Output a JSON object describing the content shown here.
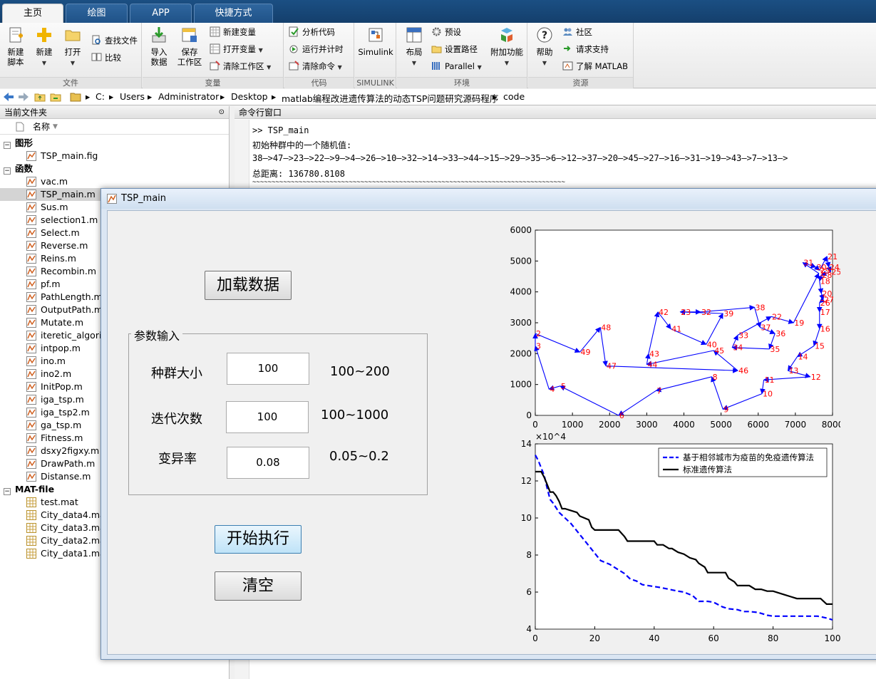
{
  "tabs": [
    "主页",
    "绘图",
    "APP",
    "快捷方式"
  ],
  "ribbon": {
    "file": {
      "label": "文件",
      "new_script": "新建\n脚本",
      "new": "新建",
      "open": "打开",
      "find_files": "查找文件",
      "compare": "比较"
    },
    "variable": {
      "label": "变量",
      "import": "导入\n数据",
      "save_ws": "保存\n工作区",
      "new_var": "新建变量",
      "open_var": "打开变量",
      "clear_ws": "清除工作区"
    },
    "code": {
      "label": "代码",
      "analyze": "分析代码",
      "run_time": "运行并计时",
      "clear_cmd": "清除命令"
    },
    "simulink": {
      "label": "SIMULINK",
      "btn": "Simulink"
    },
    "env": {
      "label": "环境",
      "layout": "布局",
      "prefs": "预设",
      "set_path": "设置路径",
      "parallel": "Parallel",
      "addons": "附加功能"
    },
    "resources": {
      "label": "资源",
      "help": "帮助",
      "community": "社区",
      "support": "请求支持",
      "learn": "了解 MATLAB"
    }
  },
  "address": {
    "parts": [
      "C:",
      "Users",
      "Administrator",
      "Desktop",
      "matlab编程改进遗传算法的动态TSP问题研究源码程序",
      "code"
    ]
  },
  "file_panel": {
    "title": "当前文件夹",
    "column": "名称",
    "sections": [
      {
        "name": "图形",
        "files": [
          "TSP_main.fig"
        ]
      },
      {
        "name": "函数",
        "files": [
          "vac.m",
          "TSP_main.m",
          "Sus.m",
          "selection1.m",
          "Select.m",
          "Reverse.m",
          "Reins.m",
          "Recombin.m",
          "pf.m",
          "PathLength.m",
          "OutputPath.m",
          "Mutate.m",
          "iteretic_algorit",
          "intpop.m",
          "ino.m",
          "ino2.m",
          "InitPop.m",
          "iga_tsp.m",
          "iga_tsp2.m",
          "ga_tsp.m",
          "Fitness.m",
          "dsxy2figxy.m",
          "DrawPath.m",
          "Distanse.m"
        ]
      },
      {
        "name": "MAT-file",
        "files": [
          "test.mat",
          "City_data4.mat",
          "City_data3.mat",
          "City_data2.mat",
          "City_data1.mat"
        ]
      }
    ],
    "selected": "TSP_main.m"
  },
  "command_window": {
    "title": "命令行窗口",
    "lines": [
      ">> TSP_main",
      "初始种群中的一个随机值:",
      "38—>47—>23—>22—>9—>4—>26—>10—>32—>14—>33—>44—>15—>29—>35—>6—>12—>37—>20—>45—>27—>16—>31—>19—>43—>7—>13—>",
      "总距离: 136780.8108",
      "~~~~~~~~~~~~~~~~~~~~~~~~~~~~~~~~~~~~~~~~~~~~~~~~~~~~~~~~~~~~~~~~~~~~~~~~~~~~~~~~~"
    ]
  },
  "figure": {
    "title": "TSP_main",
    "load_button": "加载数据",
    "param_title": "参数输入",
    "params": [
      {
        "label": "种群大小",
        "value": "100",
        "range": "100~200"
      },
      {
        "label": "迭代次数",
        "value": "100",
        "range": "100~1000"
      },
      {
        "label": "变异率",
        "value": "0.08",
        "range": "0.05~0.2"
      }
    ],
    "start_button": "开始执行",
    "clear_button": "清空"
  },
  "colors": {
    "route": "#0000ff",
    "city_label": "#ff0000",
    "ribbon_tab_bg": "#1b4f83"
  },
  "chart_data": [
    {
      "type": "scatter",
      "xlim": [
        0,
        8000
      ],
      "ylim": [
        0,
        6000
      ],
      "xticks": [
        0,
        1000,
        2000,
        3000,
        4000,
        5000,
        6000,
        7000,
        8000
      ],
      "yticks": [
        0,
        1000,
        2000,
        3000,
        4000,
        5000,
        6000
      ],
      "points": [
        {
          "id": 1,
          "x": 7630,
          "y": 4600
        },
        {
          "id": 2,
          "x": 0,
          "y": 2650
        },
        {
          "id": 3,
          "x": 0,
          "y": 2250
        },
        {
          "id": 4,
          "x": 370,
          "y": 850
        },
        {
          "id": 5,
          "x": 670,
          "y": 950
        },
        {
          "id": 6,
          "x": 2240,
          "y": 0
        },
        {
          "id": 7,
          "x": 3250,
          "y": 800
        },
        {
          "id": 8,
          "x": 4750,
          "y": 1250
        },
        {
          "id": 9,
          "x": 5050,
          "y": 200
        },
        {
          "id": 10,
          "x": 6100,
          "y": 700
        },
        {
          "id": 11,
          "x": 6150,
          "y": 1150
        },
        {
          "id": 12,
          "x": 7400,
          "y": 1250
        },
        {
          "id": 13,
          "x": 6800,
          "y": 1450
        },
        {
          "id": 14,
          "x": 7050,
          "y": 1900
        },
        {
          "id": 15,
          "x": 7500,
          "y": 2250
        },
        {
          "id": 16,
          "x": 7650,
          "y": 2800
        },
        {
          "id": 17,
          "x": 7650,
          "y": 3350
        },
        {
          "id": 18,
          "x": 7650,
          "y": 4350
        },
        {
          "id": 19,
          "x": 6950,
          "y": 3000
        },
        {
          "id": 20,
          "x": 7700,
          "y": 3950
        },
        {
          "id": 21,
          "x": 7850,
          "y": 5150
        },
        {
          "id": 22,
          "x": 6350,
          "y": 3200
        },
        {
          "id": 23,
          "x": 3900,
          "y": 3350
        },
        {
          "id": 24,
          "x": 7900,
          "y": 4800
        },
        {
          "id": 25,
          "x": 7950,
          "y": 4650
        },
        {
          "id": 26,
          "x": 7650,
          "y": 3650
        },
        {
          "id": 27,
          "x": 7750,
          "y": 3750
        },
        {
          "id": 28,
          "x": 7700,
          "y": 4550
        },
        {
          "id": 29,
          "x": 7650,
          "y": 4700
        },
        {
          "id": 30,
          "x": 7550,
          "y": 4800
        },
        {
          "id": 31,
          "x": 7200,
          "y": 4950
        },
        {
          "id": 32,
          "x": 4450,
          "y": 3350
        },
        {
          "id": 33,
          "x": 5450,
          "y": 2600
        },
        {
          "id": 34,
          "x": 5300,
          "y": 2200
        },
        {
          "id": 35,
          "x": 6300,
          "y": 2150
        },
        {
          "id": 36,
          "x": 6450,
          "y": 2650
        },
        {
          "id": 37,
          "x": 6050,
          "y": 2850
        },
        {
          "id": 38,
          "x": 5900,
          "y": 3500
        },
        {
          "id": 39,
          "x": 5050,
          "y": 3300
        },
        {
          "id": 40,
          "x": 4600,
          "y": 2300
        },
        {
          "id": 41,
          "x": 3650,
          "y": 2800
        },
        {
          "id": 42,
          "x": 3300,
          "y": 3350
        },
        {
          "id": 43,
          "x": 3050,
          "y": 2000
        },
        {
          "id": 44,
          "x": 3000,
          "y": 1650
        },
        {
          "id": 45,
          "x": 4800,
          "y": 2100
        },
        {
          "id": 46,
          "x": 5450,
          "y": 1450
        },
        {
          "id": 47,
          "x": 1900,
          "y": 1600
        },
        {
          "id": 48,
          "x": 1750,
          "y": 2850
        },
        {
          "id": 49,
          "x": 1200,
          "y": 2050
        }
      ],
      "route": [
        1,
        31,
        30,
        29,
        21,
        24,
        25,
        28,
        18,
        20,
        27,
        26,
        17,
        16,
        15,
        14,
        13,
        12,
        11,
        10,
        9,
        8,
        7,
        6,
        5,
        4,
        3,
        2,
        49,
        48,
        47,
        46,
        45,
        44,
        43,
        42,
        41,
        40,
        39,
        23,
        32,
        38,
        37,
        36,
        35,
        34,
        33,
        22,
        19,
        1
      ]
    },
    {
      "type": "line",
      "xlim": [
        0,
        100
      ],
      "ylim": [
        4,
        14
      ],
      "y_exponent": "×10^4",
      "xticks": [
        0,
        20,
        40,
        60,
        80,
        100
      ],
      "yticks": [
        4,
        6,
        8,
        10,
        12,
        14
      ],
      "legend_position": "top-right",
      "series": [
        {
          "name": "基于相邻城市为疫苗的免疫遗传算法",
          "style": "dashed",
          "x": [
            0,
            1,
            2,
            3,
            4,
            5,
            6,
            8,
            10,
            12,
            14,
            16,
            18,
            20,
            22,
            25,
            28,
            30,
            32,
            34,
            36,
            38,
            40,
            42,
            45,
            48,
            50,
            53,
            55,
            58,
            60,
            63,
            65,
            68,
            70,
            72,
            75,
            78,
            80,
            85,
            90,
            95,
            98,
            100
          ],
          "y": [
            13.4,
            13.1,
            12.7,
            12.3,
            11.6,
            11.0,
            10.8,
            10.3,
            10.0,
            9.7,
            9.3,
            8.9,
            8.5,
            8.1,
            7.7,
            7.5,
            7.2,
            7.0,
            6.7,
            6.6,
            6.4,
            6.35,
            6.3,
            6.25,
            6.15,
            6.05,
            6.0,
            5.8,
            5.5,
            5.5,
            5.45,
            5.2,
            5.1,
            5.05,
            4.95,
            4.95,
            4.9,
            4.75,
            4.7,
            4.7,
            4.7,
            4.7,
            4.6,
            4.5
          ]
        },
        {
          "name": "标准遗传算法",
          "style": "solid",
          "x": [
            0,
            2,
            3,
            4,
            5,
            6,
            7,
            8,
            9,
            10,
            14,
            15,
            18,
            19,
            20,
            21,
            25,
            28,
            30,
            31,
            33,
            35,
            40,
            41,
            43,
            45,
            46,
            48,
            50,
            52,
            54,
            55,
            57,
            58,
            60,
            64,
            65,
            66,
            67,
            68,
            70,
            71,
            72,
            74,
            76,
            78,
            80,
            84,
            86,
            88,
            90,
            94,
            96,
            98,
            100
          ],
          "y": [
            12.5,
            12.5,
            12.2,
            11.8,
            11.4,
            11.4,
            11.2,
            10.9,
            10.5,
            10.5,
            10.3,
            10.1,
            9.9,
            9.5,
            9.35,
            9.35,
            9.35,
            9.35,
            9.0,
            8.75,
            8.75,
            8.75,
            8.75,
            8.55,
            8.55,
            8.35,
            8.35,
            8.15,
            8.05,
            7.85,
            7.75,
            7.55,
            7.35,
            7.05,
            7.05,
            7.05,
            6.75,
            6.65,
            6.55,
            6.35,
            6.35,
            6.35,
            6.35,
            6.15,
            6.15,
            6.05,
            6.05,
            5.85,
            5.75,
            5.65,
            5.65,
            5.65,
            5.65,
            5.35,
            5.35
          ]
        }
      ]
    }
  ]
}
